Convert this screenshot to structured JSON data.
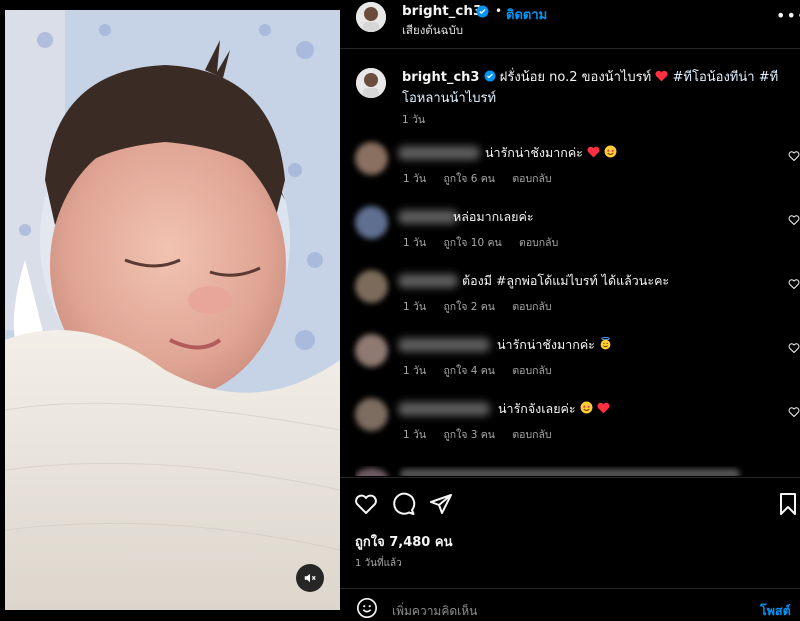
{
  "header": {
    "username": "bright_ch3",
    "separator": "•",
    "follow_label": "ติดตาม",
    "audio_label": "เสียงต้นฉบับ",
    "more_label": "•••"
  },
  "caption": {
    "username": "bright_ch3",
    "text": "ฝรั่งน้อย no.2 ของน้าไบรท์",
    "hashtag1": "#ทีโอน้องทีน่า",
    "hashtag2": "#ทีโอหลานน้าไบรท์",
    "time": "1 วัน"
  },
  "comments": [
    {
      "text": "น่ารักน่าชังมากค่ะ",
      "emojis": "heart,star-eyes",
      "time": "1 วัน",
      "likes": "ถูกใจ 6 คน",
      "reply": "ตอบกลับ"
    },
    {
      "text": "หล่อมากเลยค่ะ",
      "emojis": "",
      "time": "1 วัน",
      "likes": "ถูกใจ 10 คน",
      "reply": "ตอบกลับ"
    },
    {
      "text": "ต้องมี #ลูกพ่อโด้แม่ไบรท์ ได้แล้วนะคะ",
      "emojis": "",
      "time": "1 วัน",
      "likes": "ถูกใจ 2 คน",
      "reply": "ตอบกลับ"
    },
    {
      "text": "น่ารักน่าชังมากค่ะ",
      "emojis": "angel",
      "time": "1 วัน",
      "likes": "ถูกใจ 4 คน",
      "reply": "ตอบกลับ"
    },
    {
      "text": "น่ารักจังเลยค่ะ",
      "emojis": "star-eyes,heart",
      "time": "1 วัน",
      "likes": "ถูกใจ 3 คน",
      "reply": "ตอบกลับ"
    }
  ],
  "post": {
    "likes": "ถูกใจ 7,480 คน",
    "time_ago": "1 วันที่แล้ว",
    "add_comment_placeholder": "เพิ่มความคิดเห็น",
    "post_label": "โพสต์"
  },
  "colors": {
    "accent": "#0095f6",
    "background": "#000000",
    "heart": "#ff3040"
  },
  "icons": [
    "mute-icon",
    "verified-icon",
    "more-icon",
    "like-icon",
    "comment-icon",
    "share-icon",
    "save-icon",
    "emoji-icon"
  ]
}
